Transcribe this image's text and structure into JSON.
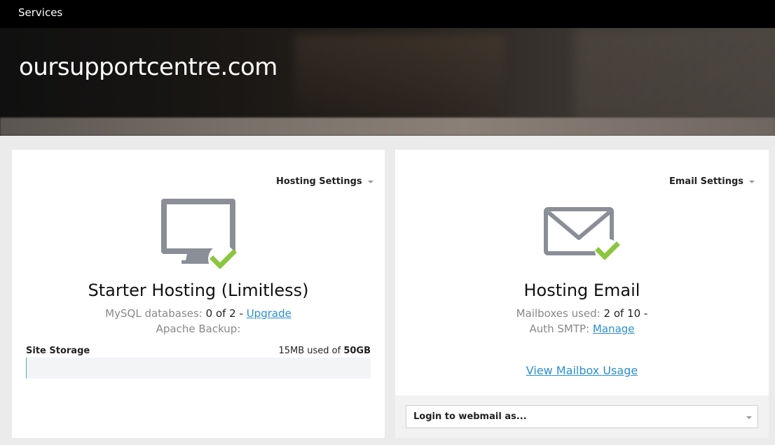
{
  "topbar": {
    "title": "Services"
  },
  "hero": {
    "domain": "oursupportcentre.com"
  },
  "hosting": {
    "settings_label": "Hosting Settings",
    "icon": "monitor-check-icon",
    "service_name": "Starter Hosting (Limitless)",
    "mysql_label": "MySQL databases:",
    "mysql_value": "0 of 2",
    "mysql_sep": " - ",
    "upgrade_link": "Upgrade",
    "backup_label": "Apache Backup:",
    "storage_label": "Site Storage",
    "storage_used_text": "15MB used of",
    "storage_total": "50GB",
    "storage_fraction": 0.0003
  },
  "email": {
    "settings_label": "Email Settings",
    "icon": "envelope-check-icon",
    "service_name": "Hosting Email",
    "mailboxes_label": "Mailboxes used:",
    "mailboxes_value": "2 of 10 -",
    "smtp_label": "Auth SMTP:",
    "smtp_link": "Manage",
    "mailbox_usage_link": "View Mailbox Usage",
    "webmail_select": "Login to webmail as..."
  },
  "colors": {
    "accent_link": "#2a8fcf",
    "check_green": "#8cc63f",
    "icon_gray": "#8a8e96"
  }
}
